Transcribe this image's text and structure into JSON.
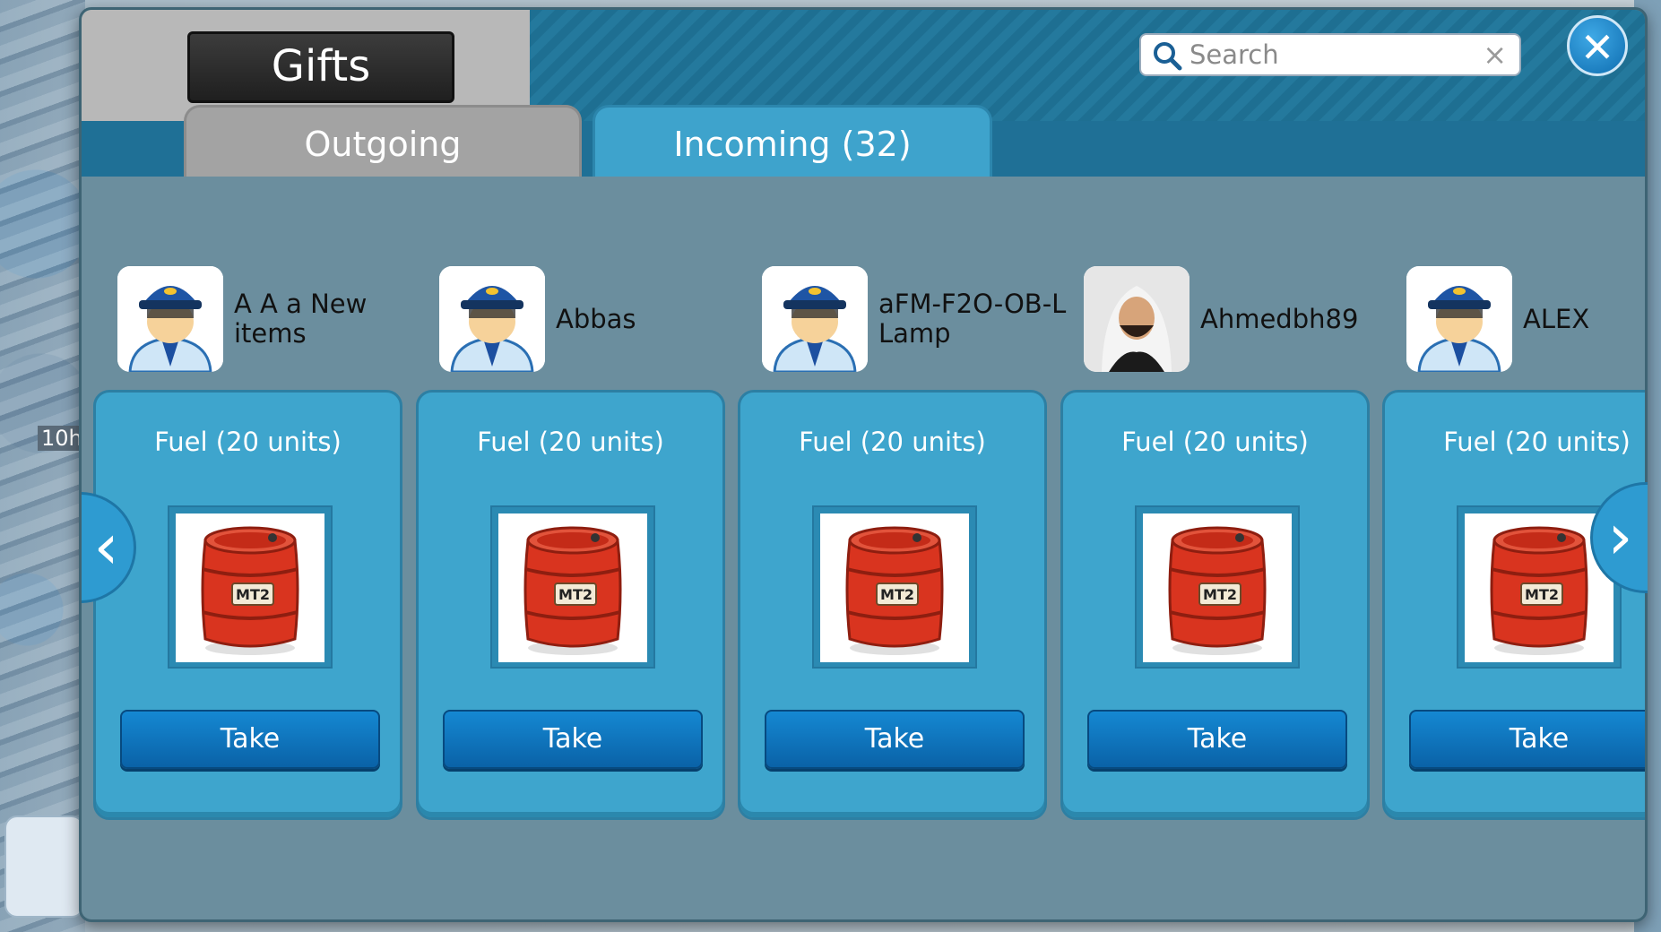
{
  "dialog": {
    "title": "Gifts",
    "close_icon": "close-icon"
  },
  "tabs": [
    {
      "label": "Outgoing",
      "active": false
    },
    {
      "label": "Incoming (32)",
      "active": true
    }
  ],
  "search": {
    "placeholder": "Search",
    "value": "",
    "icon": "search-icon",
    "clear_icon": "clear-icon"
  },
  "gifts": [
    {
      "sender": "A A a New items",
      "avatar": "pilot-avatar",
      "item": "Fuel (20 units)",
      "item_icon": "fuel-barrel-icon",
      "barrel_label": "MT2",
      "action": "Take"
    },
    {
      "sender": "Abbas",
      "avatar": "pilot-avatar",
      "item": "Fuel (20 units)",
      "item_icon": "fuel-barrel-icon",
      "barrel_label": "MT2",
      "action": "Take"
    },
    {
      "sender": "aFM-F2O-OB-L Lamp",
      "avatar": "pilot-avatar",
      "item": "Fuel (20 units)",
      "item_icon": "fuel-barrel-icon",
      "barrel_label": "MT2",
      "action": "Take"
    },
    {
      "sender": "Ahmedbh89",
      "avatar": "photo-avatar",
      "item": "Fuel (20 units)",
      "item_icon": "fuel-barrel-icon",
      "barrel_label": "MT2",
      "action": "Take"
    },
    {
      "sender": "ALEX",
      "avatar": "pilot-avatar",
      "item": "Fuel (20 units)",
      "item_icon": "fuel-barrel-icon",
      "barrel_label": "MT2",
      "action": "Take"
    }
  ],
  "nav": {
    "prev_icon": "chevron-left-icon",
    "next_icon": "chevron-right-icon"
  },
  "background": {
    "timer_text": "10h"
  },
  "colors": {
    "accent": "#3ea5cd",
    "button": "#0f73bd",
    "tab_active": "#3ea3cc",
    "tab_inactive": "#a3a3a3",
    "barrel": "#d9341f"
  }
}
